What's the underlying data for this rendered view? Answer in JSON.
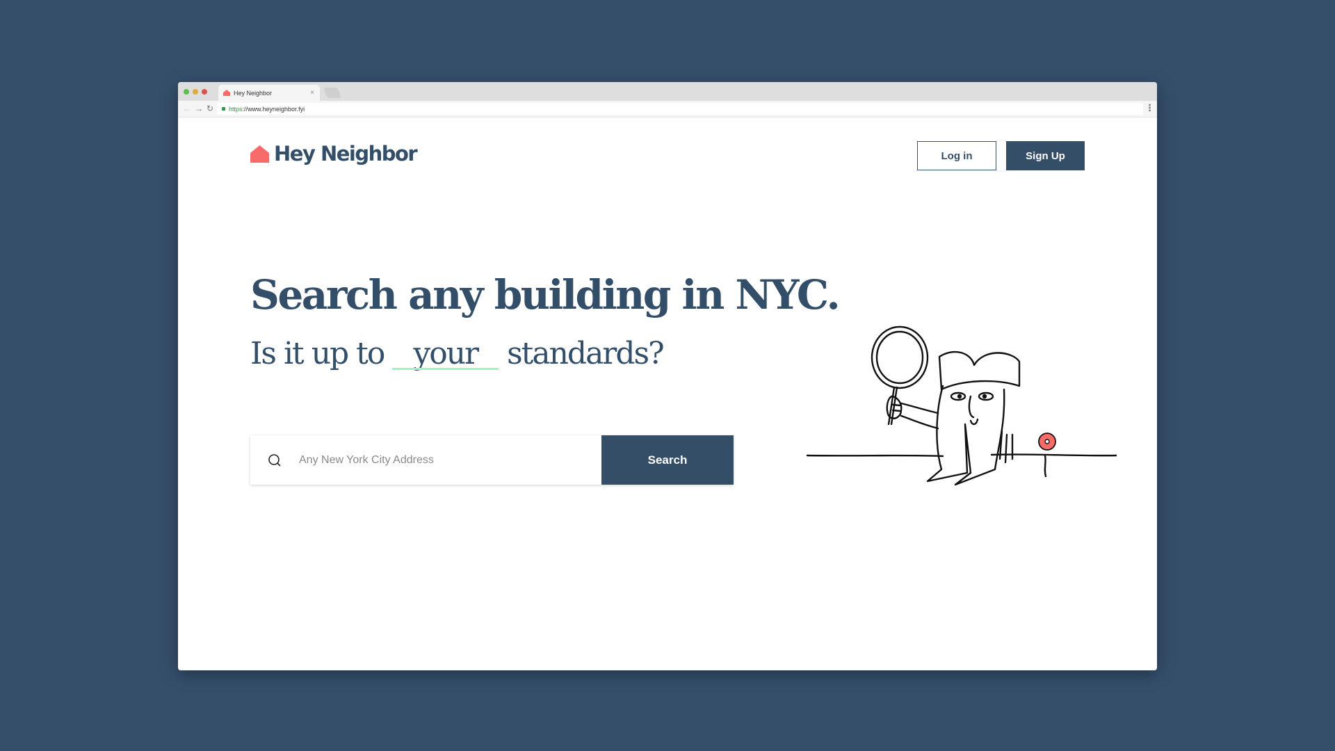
{
  "browser": {
    "tab_title": "Hey Neighbor",
    "tab_close": "×",
    "url_scheme": "https",
    "url_rest": "://www.heyneighbor.fyi",
    "nav": {
      "back": "←",
      "forward": "→",
      "reload": "↻",
      "menu": "•••"
    }
  },
  "header": {
    "logo_text": "Hey Neighbor",
    "login_label": "Log in",
    "signup_label": "Sign Up"
  },
  "hero": {
    "headline": "Search any building in NYC.",
    "subhead_prefix": "Is it up to",
    "subhead_emphasis": "your",
    "subhead_suffix": "standards?"
  },
  "search": {
    "placeholder": "Any New York City Address",
    "value": "",
    "button_label": "Search"
  },
  "colors": {
    "background": "#354f6b",
    "brand_navy": "#334e68",
    "brand_coral": "#f76b69",
    "highlight_green": "#a6f0c6"
  },
  "icons": {
    "favicon": "house-icon",
    "logo": "house-icon",
    "search": "search-icon"
  }
}
